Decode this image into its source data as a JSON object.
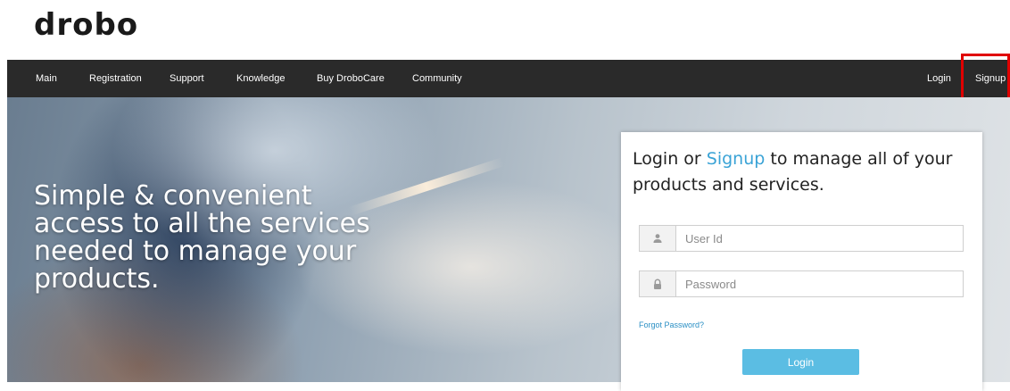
{
  "logo": {
    "text": "drobo"
  },
  "nav": {
    "items": [
      {
        "label": "Main"
      },
      {
        "label": "Registration"
      },
      {
        "label": "Support"
      },
      {
        "label": "Knowledge"
      },
      {
        "label": "Buy DroboCare"
      },
      {
        "label": "Community"
      }
    ],
    "login": "Login",
    "signup": "Signup"
  },
  "hero": {
    "lines": [
      "Simple & convenient",
      "access to all the services",
      "needed to manage your",
      "products."
    ]
  },
  "login_panel": {
    "heading_prefix": "Login or ",
    "heading_link": "Signup",
    "heading_suffix": " to manage all of your products and services.",
    "user_placeholder": "User Id",
    "password_placeholder": "Password",
    "forgot_password": "Forgot Password?",
    "login_button": "Login",
    "user_icon": "user-icon",
    "lock_icon": "lock-icon"
  },
  "colors": {
    "nav_background": "#2a2a2a",
    "accent": "#3aa3d6",
    "button": "#5bbde3",
    "highlight": "#e00000"
  }
}
